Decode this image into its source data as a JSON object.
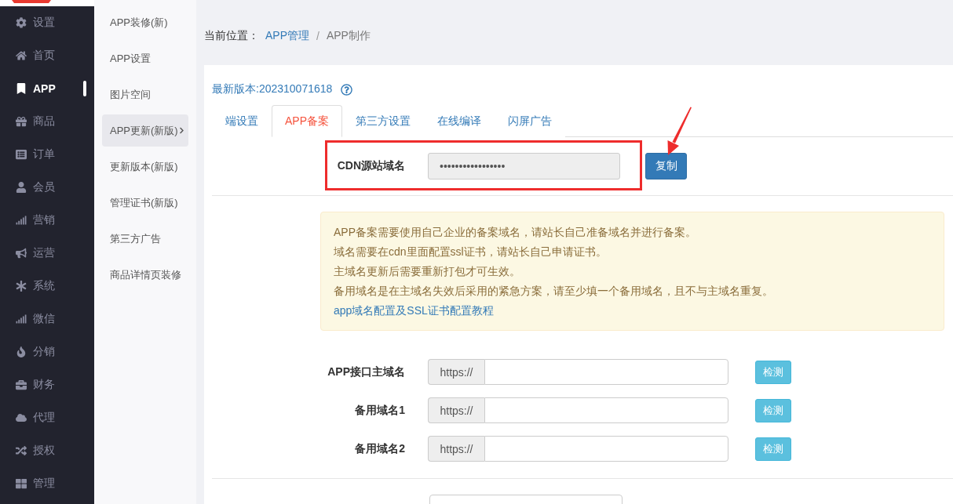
{
  "sidebar": {
    "items": [
      {
        "label": "设置",
        "selected": false
      },
      {
        "label": "首页",
        "selected": false
      },
      {
        "label": "APP",
        "selected": true
      },
      {
        "label": "商品",
        "selected": false
      },
      {
        "label": "订单",
        "selected": false
      },
      {
        "label": "会员",
        "selected": false
      },
      {
        "label": "营销",
        "selected": false
      },
      {
        "label": "运营",
        "selected": false
      },
      {
        "label": "系统",
        "selected": false
      },
      {
        "label": "微信",
        "selected": false
      },
      {
        "label": "分销",
        "selected": false
      },
      {
        "label": "财务",
        "selected": false
      },
      {
        "label": "代理",
        "selected": false
      },
      {
        "label": "授权",
        "selected": false
      },
      {
        "label": "管理",
        "selected": false
      }
    ]
  },
  "subnav": {
    "items": [
      {
        "label": "APP装修(新)",
        "selected": false,
        "expandable": false
      },
      {
        "label": "APP设置",
        "selected": false,
        "expandable": false
      },
      {
        "label": "图片空间",
        "selected": false,
        "expandable": false
      },
      {
        "label": "APP更新(新版)",
        "selected": true,
        "expandable": true
      },
      {
        "label": "更新版本(新版)",
        "selected": false,
        "expandable": false
      },
      {
        "label": "管理证书(新版)",
        "selected": false,
        "expandable": false
      },
      {
        "label": "第三方广告",
        "selected": false,
        "expandable": false
      },
      {
        "label": "商品详情页装修",
        "selected": false,
        "expandable": false
      }
    ]
  },
  "breadcrumb": {
    "label": "当前位置：",
    "separator": "/",
    "items": [
      {
        "text": "APP管理",
        "kind": "link"
      },
      {
        "text": "APP制作",
        "kind": "current"
      }
    ]
  },
  "version": {
    "text": "最新版本:202310071618"
  },
  "tabs": [
    {
      "label": "端设置",
      "selected": false
    },
    {
      "label": "APP备案",
      "selected": true
    },
    {
      "label": "第三方设置",
      "selected": false
    },
    {
      "label": "在线编译",
      "selected": false
    },
    {
      "label": "闪屏广告",
      "selected": false
    }
  ],
  "cdn": {
    "label": "CDN源站域名",
    "value": "•••••••••••••••••",
    "button": "复制",
    "highlighted": true,
    "pointer_arrow": true
  },
  "notice": {
    "lines": [
      "APP备案需要使用自己企业的备案域名，请站长自己准备域名并进行备案。",
      "域名需要在cdn里面配置ssl证书，请站长自己申请证书。",
      "主域名更新后需要重新打包才可生效。",
      "备用域名是在主域名失效后采用的紧急方案，请至少填一个备用域名，且不与主域名重复。"
    ],
    "link": "app域名配置及SSL证书配置教程"
  },
  "domains": [
    {
      "label": "APP接口主域名",
      "prefix": "https://",
      "button": "检测"
    },
    {
      "label": "备用域名1",
      "prefix": "https://",
      "button": "检测"
    },
    {
      "label": "备用域名2",
      "prefix": "https://",
      "button": "检测"
    }
  ]
}
